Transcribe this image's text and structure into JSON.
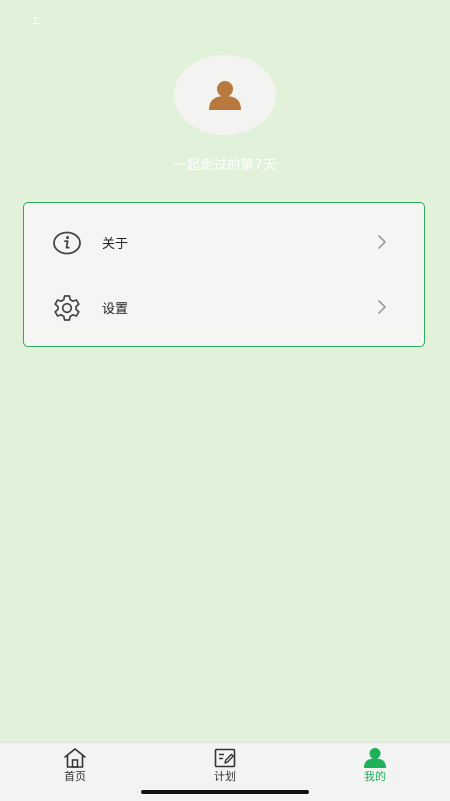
{
  "status_bar": {
    "time": "上"
  },
  "profile": {
    "tagline": "一起走过的第7天"
  },
  "menu": {
    "items": [
      {
        "label": "关于",
        "icon": "info-icon"
      },
      {
        "label": "设置",
        "icon": "gear-icon"
      }
    ]
  },
  "tab_bar": {
    "tabs": [
      {
        "label": "首页",
        "icon": "home-icon",
        "active": false
      },
      {
        "label": "计划",
        "icon": "plan-icon",
        "active": false
      },
      {
        "label": "我的",
        "icon": "user-icon",
        "active": true
      }
    ]
  },
  "colors": {
    "background": "#e2f2da",
    "accent": "#1db15a",
    "card_border": "#2fad5f",
    "avatar": "#b9783e"
  }
}
